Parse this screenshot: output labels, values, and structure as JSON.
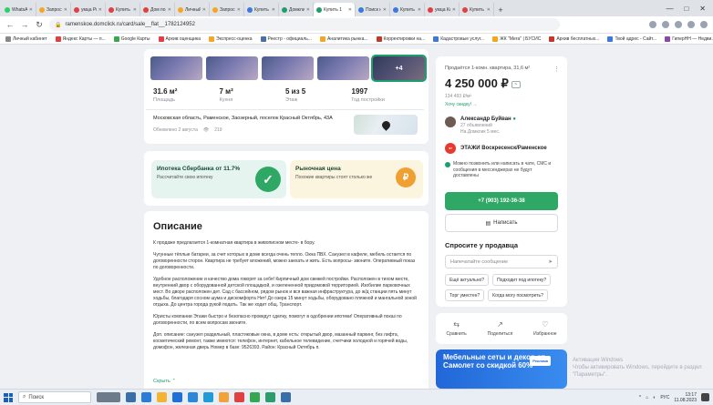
{
  "browser": {
    "tabs": [
      {
        "label": "WhatsApp",
        "color": "#25d366"
      },
      {
        "label": "Запрос о",
        "color": "#f5a623"
      },
      {
        "label": "умца Ро",
        "color": "#e04040"
      },
      {
        "label": "Купить о",
        "color": "#e04040"
      },
      {
        "label": "Дом по о",
        "color": "#e04040"
      },
      {
        "label": "Личный",
        "color": "#f5a623"
      },
      {
        "label": "Запрос о",
        "color": "#f5a623"
      },
      {
        "label": "Купить н",
        "color": "#3b7bd8"
      },
      {
        "label": "Домклик",
        "color": "#1e9e6a"
      },
      {
        "label": "Купить 1",
        "color": "#1e9e6a",
        "active": true
      },
      {
        "label": "Поиск н",
        "color": "#3b7bd8"
      },
      {
        "label": "Купить о",
        "color": "#3b7bd8"
      },
      {
        "label": "умца Кл",
        "color": "#e04040"
      },
      {
        "label": "Купить о",
        "color": "#e04040"
      }
    ],
    "url": "ramenskoe.domclick.ru/card/sale__flat__1782124952",
    "bookmarks": [
      {
        "label": "Личный кабинет",
        "color": "#888"
      },
      {
        "label": "Яндекс Карты — п...",
        "color": "#e04040"
      },
      {
        "label": "Google Карты",
        "color": "#34a853"
      },
      {
        "label": "Архив оценщика",
        "color": "#e04040"
      },
      {
        "label": "Экспресс-оценка",
        "color": "#f5a623"
      },
      {
        "label": "Реестр - официаль...",
        "color": "#4a6fa5"
      },
      {
        "label": "Аналитика рынка...",
        "color": "#f5a623"
      },
      {
        "label": "Корректировки на...",
        "color": "#c0392b"
      },
      {
        "label": "Кадастровые услуг...",
        "color": "#3b7bd8"
      },
      {
        "label": "ЖК \"Мега\" | БУСИС",
        "color": "#f5a623"
      },
      {
        "label": "Архив бесплатных...",
        "color": "#c0392b"
      },
      {
        "label": "Твой адрес - Сайт...",
        "color": "#3b7bd8"
      },
      {
        "label": "ГиперНН — Недви...",
        "color": "#8e44ad"
      }
    ]
  },
  "listing": {
    "photos_more": "+4",
    "stats": [
      {
        "value": "31.6 м²",
        "label": "Площадь"
      },
      {
        "value": "7 м²",
        "label": "Кухня"
      },
      {
        "value": "5 из 5",
        "label": "Этаж"
      },
      {
        "value": "1997",
        "label": "Год постройки"
      }
    ],
    "address": "Московская область, Раменское, Заозерный, поселок Красный Октябрь, 43А",
    "updated": "Обновлено 2 августа",
    "views": "219",
    "promo_mortgage": {
      "title": "Ипотека Сбербанка от 11.7%",
      "subtitle": "Рассчитайте свою ипотеку"
    },
    "promo_market": {
      "title": "Рыночная цена",
      "subtitle": "Похожие квартиры стоят столько же"
    },
    "description_title": "Описание",
    "description": [
      "К продаже предлагается 1-комнатная квартира в живописном месте- в бору.",
      "Чугунные тёплые батареи, за счет которых в доме всегда очень тепло. Окна ПВХ. Санузел в кафеле, мебель остается по договоренности сторон. Квартира не требует вложений, можно заехать и жить. Есть вопросы- звоните. Оперативный показ по договоренности.",
      "Удобное расположение и качество дома говорят за себя! Кирпичный дом свежей постройки. Расположен в тихом месте, внутренний двор с оборудованной детской площадкой, и озелененной придомовой территорией. Изобилие парковочных мест. Во дворе расположен дет. Сад с бассейном, рядом рынок и вся важная инфраструктура, до ж/д станции пять минут ходьбы, благодаря сосном шума и дискомфорта Нет! До озера 15 минут ходьбы, оборудовано пляжной и мангальной зоной отдыха. До центра города рукой подать. Так же ходит общ. Транспорт.",
      "Юристы компании Этажи быстро и безопасно проведут сделку, помогут в одобрении ипотеки! Оперативный показ по договоренности, по всем вопросам звоните.",
      "Доп. описание: санузел раздельный, пластиковые окна, в доме есть: открытый двор, мазанный паркинг, без лифта, косметический ремонт, также имеются: телефон, интернет, кабельное телевидение, счетчики холодной и горячей воды, домофон, железная дверь Номер в базе: 9526393. Район: Красный Октябрь п."
    ],
    "collapse_label": "Скрыть"
  },
  "sidebar": {
    "subtitle": "Продаётся 1-комн. квартира, 31,6 м²",
    "price": "4 250 000 ₽",
    "price_per_sqm": "134 493 ₽/м²",
    "discount_link": "Хочу скидку! →",
    "agent_name": "Александр Буйван",
    "agent_ads": "27 объявлений",
    "agent_since": "На Домклик 5 мес.",
    "agency": "ЭТАЖИ Воскресенск/Раменское",
    "notice": "Можно позвонить или написать в чате, СМС и сообщения в мессенджерах не будут доставлены",
    "phone": "+7 (903) 192-36-38",
    "write_label": "Написать",
    "ask_title": "Спросите у продавца",
    "ask_placeholder": "Напечатайте сообщение",
    "chips": [
      "Ещё актуально?",
      "Подходит под ипотеку?",
      "Торг уместен?",
      "Когда могу посмотреть?"
    ],
    "actions": [
      {
        "label": "Сравнить",
        "icon": "compare-icon"
      },
      {
        "label": "Поделиться",
        "icon": "share-icon"
      },
      {
        "label": "Избранное",
        "icon": "heart-icon"
      }
    ],
    "banner_text": "Мебельные сеты и декор от Самолет со скидкой 60%",
    "banner_tag": "Реклама"
  },
  "watermark": "Активация Windows\nЧтобы активировать Windows, перейдите в раздел \"Параметры\".",
  "taskbar": {
    "search_label": "Поиск",
    "time": "13:17",
    "date": "11.08.2023",
    "lang": "РУС"
  }
}
